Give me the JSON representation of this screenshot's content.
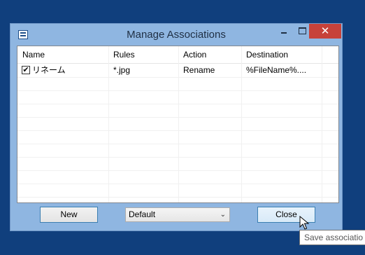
{
  "window": {
    "title": "Manage Associations"
  },
  "columns": [
    "Name",
    "Rules",
    "Action",
    "Destination"
  ],
  "rows": [
    {
      "checked": true,
      "check_glyph": "✔",
      "name": "リネーム",
      "rules": "*.jpg",
      "action": "Rename",
      "destination": "%FileName%...."
    }
  ],
  "buttons": {
    "new": "New",
    "close": "Close"
  },
  "profile_select": {
    "value": "Default"
  },
  "tooltip": {
    "text": "Save associatio"
  },
  "title_controls": {
    "min": "minimize-icon",
    "max": "maximize-icon",
    "close": "✕"
  },
  "colors": {
    "desktop": "#103f7d",
    "frame": "#8fb6e1",
    "close_button": "#c7423a"
  }
}
